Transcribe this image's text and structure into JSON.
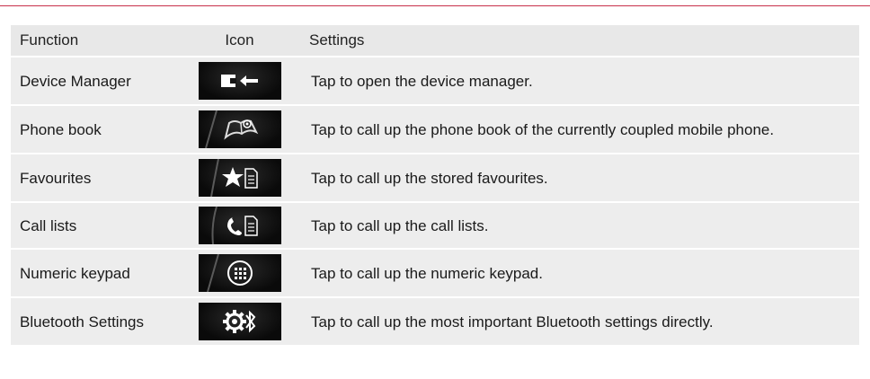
{
  "table": {
    "headers": {
      "function": "Function",
      "icon": "Icon",
      "settings": "Settings"
    },
    "rows": [
      {
        "function": "Device Manager",
        "icon": "device-manager-icon",
        "settings": "Tap to open the device manager."
      },
      {
        "function": "Phone book",
        "icon": "phone-book-icon",
        "settings": "Tap to call up the phone book of the currently coupled mobile phone."
      },
      {
        "function": "Favourites",
        "icon": "favourites-star-icon",
        "settings": "Tap to call up the stored favourites."
      },
      {
        "function": "Call lists",
        "icon": "call-lists-icon",
        "settings": "Tap to call up the call lists."
      },
      {
        "function": "Numeric keypad",
        "icon": "numeric-keypad-icon",
        "settings": "Tap to call up the numeric keypad."
      },
      {
        "function": "Bluetooth Settings",
        "icon": "bluetooth-settings-icon",
        "settings": "Tap to call up the most important Bluetooth settings directly."
      }
    ]
  },
  "colors": {
    "accent_rule": "#c8314b",
    "row_background": "#ededed",
    "header_background": "#e8e8e8"
  }
}
